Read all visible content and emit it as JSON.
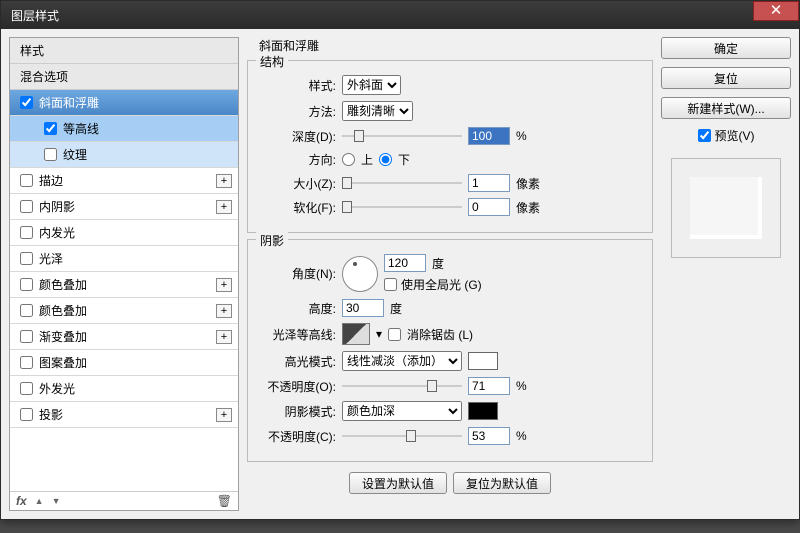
{
  "window": {
    "title": "图层样式"
  },
  "sidebar": {
    "head1": "样式",
    "head2": "混合选项",
    "items": [
      {
        "label": "斜面和浮雕",
        "checked": true,
        "selected": true
      },
      {
        "label": "等高线",
        "checked": true,
        "sub": true,
        "sel2": true
      },
      {
        "label": "纹理",
        "checked": false,
        "sub": true
      },
      {
        "label": "描边",
        "checked": false,
        "plus": true
      },
      {
        "label": "内阴影",
        "checked": false,
        "plus": true
      },
      {
        "label": "内发光",
        "checked": false
      },
      {
        "label": "光泽",
        "checked": false
      },
      {
        "label": "颜色叠加",
        "checked": false,
        "plus": true
      },
      {
        "label": "颜色叠加",
        "checked": false,
        "plus": true
      },
      {
        "label": "渐变叠加",
        "checked": false,
        "plus": true
      },
      {
        "label": "图案叠加",
        "checked": false
      },
      {
        "label": "外发光",
        "checked": false
      },
      {
        "label": "投影",
        "checked": false,
        "plus": true
      }
    ],
    "fx": "fx"
  },
  "panel": {
    "title": "斜面和浮雕",
    "structure": {
      "legend": "结构",
      "style_label": "样式:",
      "style_value": "外斜面",
      "technique_label": "方法:",
      "technique_value": "雕刻清晰",
      "depth_label": "深度(D):",
      "depth_value": "100",
      "depth_unit": "%",
      "direction_label": "方向:",
      "up": "上",
      "down": "下",
      "size_label": "大小(Z):",
      "size_value": "1",
      "size_unit": "像素",
      "soften_label": "软化(F):",
      "soften_value": "0",
      "soften_unit": "像素"
    },
    "shading": {
      "legend": "阴影",
      "angle_label": "角度(N):",
      "angle_value": "120",
      "angle_unit": "度",
      "global_light": "使用全局光 (G)",
      "altitude_label": "高度:",
      "altitude_value": "30",
      "altitude_unit": "度",
      "gloss_label": "光泽等高线:",
      "antialias": "消除锯齿 (L)",
      "highlight_mode_label": "高光模式:",
      "highlight_mode_value": "线性减淡（添加）",
      "highlight_opacity_label": "不透明度(O):",
      "highlight_opacity_value": "71",
      "opacity_unit": "%",
      "shadow_mode_label": "阴影模式:",
      "shadow_mode_value": "颜色加深",
      "shadow_opacity_label": "不透明度(C):",
      "shadow_opacity_value": "53"
    },
    "buttons": {
      "make_default": "设置为默认值",
      "reset_default": "复位为默认值"
    }
  },
  "right": {
    "ok": "确定",
    "cancel": "复位",
    "new_style": "新建样式(W)...",
    "preview_label": "预览(V)"
  }
}
